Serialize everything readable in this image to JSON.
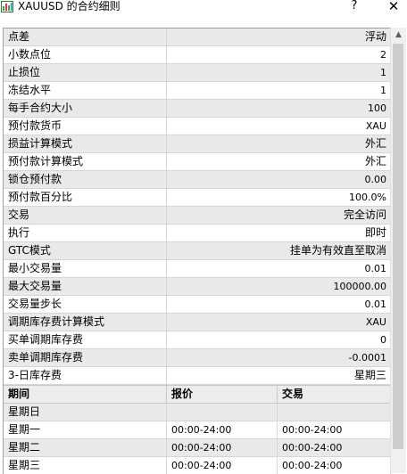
{
  "window": {
    "title": "XAUUSD 的合约细则",
    "help": "?",
    "close": "✕"
  },
  "properties": [
    {
      "name": "点差",
      "value": "浮动"
    },
    {
      "name": "小数点位",
      "value": "2"
    },
    {
      "name": "止损位",
      "value": "1"
    },
    {
      "name": "冻结水平",
      "value": "1"
    },
    {
      "name": "每手合约大小",
      "value": "100"
    },
    {
      "name": "预付款货币",
      "value": "XAU"
    },
    {
      "name": "损益计算模式",
      "value": "外汇"
    },
    {
      "name": "预付款计算模式",
      "value": "外汇"
    },
    {
      "name": "锁仓预付款",
      "value": "0.00"
    },
    {
      "name": "预付款百分比",
      "value": "100.0%"
    },
    {
      "name": "交易",
      "value": "完全访问"
    },
    {
      "name": "执行",
      "value": "即时"
    },
    {
      "name": "GTC模式",
      "value": "挂单为有效直至取消"
    },
    {
      "name": "最小交易量",
      "value": "0.01"
    },
    {
      "name": "最大交易量",
      "value": "100000.00"
    },
    {
      "name": "交易量步长",
      "value": "0.01"
    },
    {
      "name": "调期库存费计算模式",
      "value": "XAU"
    },
    {
      "name": "买单调期库存费",
      "value": "0"
    },
    {
      "name": "卖单调期库存费",
      "value": "-0.0001"
    },
    {
      "name": "3-日库存费",
      "value": "星期三"
    }
  ],
  "sessions": {
    "headers": [
      "期间",
      "报价",
      "交易"
    ],
    "rows": [
      {
        "day": "星期日",
        "quote": "",
        "trade": ""
      },
      {
        "day": "星期一",
        "quote": "00:00-24:00",
        "trade": "00:00-24:00"
      },
      {
        "day": "星期二",
        "quote": "00:00-24:00",
        "trade": "00:00-24:00"
      },
      {
        "day": "星期三",
        "quote": "00:00-24:00",
        "trade": "00:00-24:00"
      }
    ]
  },
  "icons": {
    "title_icon": "chart-window-icon",
    "scroll_up": "arrow-up-icon"
  }
}
